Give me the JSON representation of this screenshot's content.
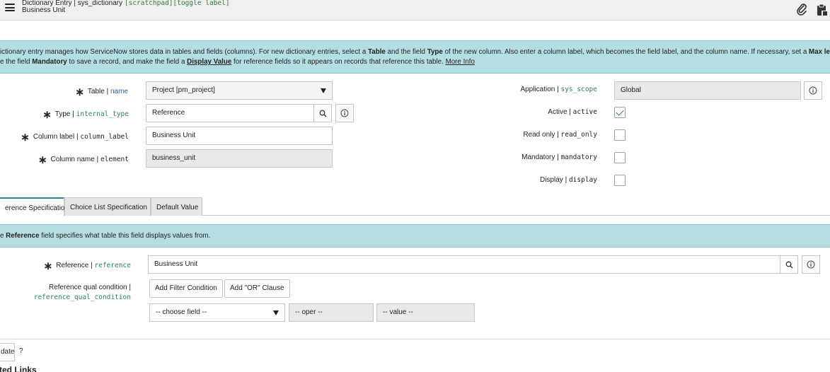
{
  "header": {
    "title_prefix": "Dictionary Entry | sys_dictionary",
    "title_links": "[scratchpad][toggle label]",
    "subtitle": "Business Unit",
    "icons": [
      "menu-icon",
      "paperclip-icon",
      "clipboard-icon"
    ]
  },
  "info_banner": {
    "line1_a": "ictionary entry manages how ServiceNow stores data in tables and fields (columns). For new dictionary entries, select a ",
    "line1_b": "Table",
    "line1_c": " and the field ",
    "line1_d": "Type",
    "line1_e": " of the new column. Also enter a column label, which becomes the field label, and the column name. If necessary, set a ",
    "line1_f": "Max length",
    "line2_a": "e the field ",
    "line2_b": "Mandatory",
    "line2_c": " to save a record, and make the field a ",
    "line2_d": "Display Value",
    "line2_e": " for reference fields so it appears on records that reference this table.",
    "line2_link": "More Info"
  },
  "form": {
    "table": {
      "label": "Table",
      "field": "name",
      "value": "Project [pm_project]"
    },
    "type": {
      "label": "Type",
      "field": "internal_type",
      "value": "Reference"
    },
    "column_label": {
      "label": "Column label",
      "field": "column_label",
      "value": "Business Unit"
    },
    "column_name": {
      "label": "Column name",
      "field": "element",
      "value": "business_unit"
    },
    "application": {
      "label": "Application",
      "field": "sys_scope",
      "value": "Global"
    },
    "active": {
      "label": "Active",
      "field": "active",
      "checked": true
    },
    "read_only": {
      "label": "Read only",
      "field": "read_only",
      "checked": false
    },
    "mandatory": {
      "label": "Mandatory",
      "field": "mandatory",
      "checked": false
    },
    "display": {
      "label": "Display",
      "field": "display",
      "checked": false
    }
  },
  "tabs": [
    {
      "label": "erence Specification",
      "active": true
    },
    {
      "label": "Choice List Specification",
      "active": false
    },
    {
      "label": "Default Value",
      "active": false
    }
  ],
  "reference_banner": {
    "a": "e ",
    "b": "Reference",
    "c": " field specifies what table this field displays values from."
  },
  "reference_section": {
    "reference": {
      "label": "Reference",
      "field": "reference",
      "value": "Business Unit"
    },
    "qual_condition": {
      "label": "Reference qual condition |",
      "field": "reference_qual_condition"
    },
    "add_filter_label": "Add Filter Condition",
    "add_or_label": "Add \"OR\" Clause",
    "choose_field": "-- choose field --",
    "oper": "-- oper --",
    "value": "-- value --"
  },
  "footer": {
    "update_label": "date",
    "help": "?",
    "related_links": "ted Links"
  },
  "colors": {
    "banner_bg": "#b5dee3",
    "accent": "#2e8a80",
    "field_name": "#2e7d6f"
  }
}
